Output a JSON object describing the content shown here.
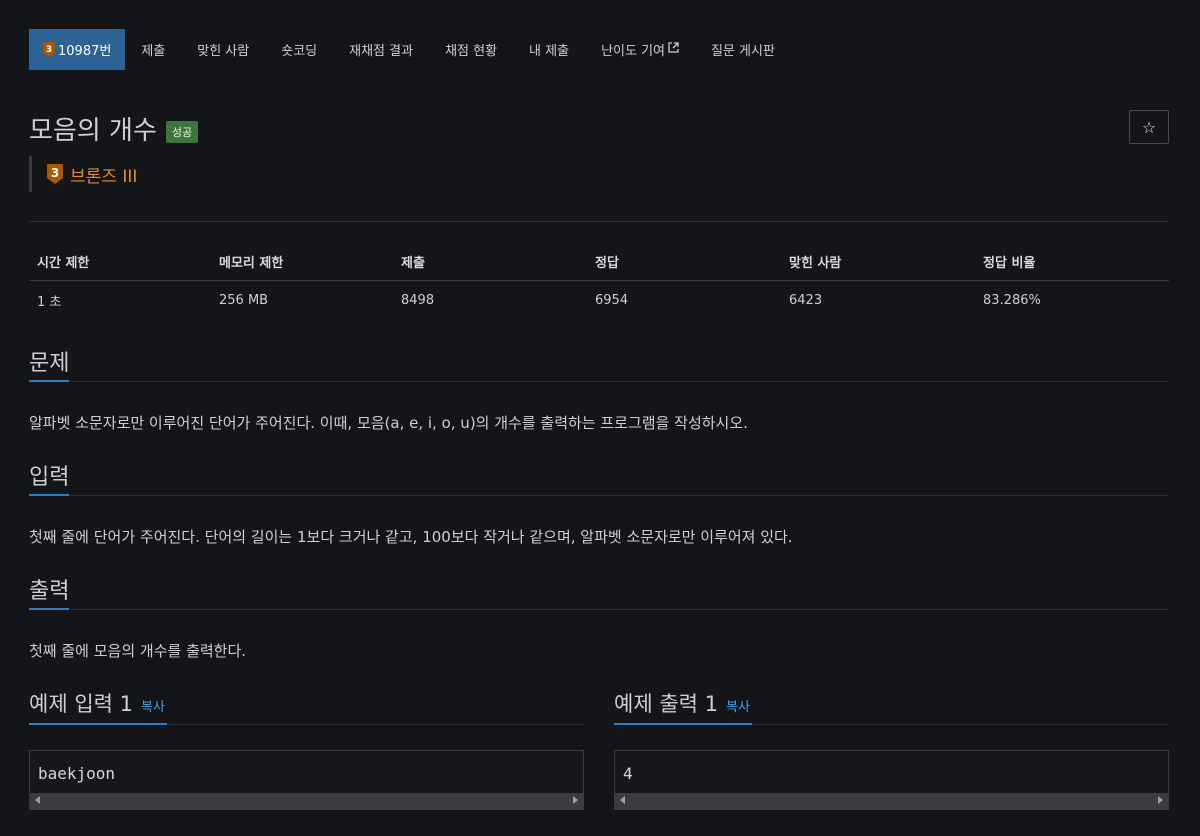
{
  "nav": {
    "problem_tab": "10987번",
    "problem_tier_digit": "3",
    "tabs": [
      "제출",
      "맞힌 사람",
      "숏코딩",
      "재채점 결과",
      "채점 현황",
      "내 제출",
      "난이도 기여",
      "질문 게시판"
    ]
  },
  "problem": {
    "title": "모음의 개수",
    "status_badge": "성공",
    "tier_digit": "3",
    "tier_label": "브론즈 III",
    "star_icon": "☆"
  },
  "info_table": {
    "headers": [
      "시간 제한",
      "메모리 제한",
      "제출",
      "정답",
      "맞힌 사람",
      "정답 비율"
    ],
    "values": [
      "1 초",
      "256 MB",
      "8498",
      "6954",
      "6423",
      "83.286%"
    ]
  },
  "sections": {
    "problem": {
      "title": "문제",
      "body": "알파벳 소문자로만 이루어진 단어가 주어진다. 이때, 모음(a, e, i, o, u)의 개수를 출력하는 프로그램을 작성하시오."
    },
    "input": {
      "title": "입력",
      "body": "첫째 줄에 단어가 주어진다. 단어의 길이는 1보다 크거나 같고, 100보다 작거나 같으며, 알파벳 소문자로만 이루어져 있다."
    },
    "output": {
      "title": "출력",
      "body": "첫째 줄에 모음의 개수를 출력한다."
    }
  },
  "samples": {
    "input": {
      "title": "예제 입력 1",
      "copy": "복사",
      "content": "baekjoon"
    },
    "output": {
      "title": "예제 출력 1",
      "copy": "복사",
      "content": "4"
    }
  },
  "colors": {
    "active_tab": "#2e6295",
    "bronze": "#e68a33",
    "success": "#3c763d",
    "accent_underline": "#2e7dc0",
    "link": "#4a9ee0"
  }
}
